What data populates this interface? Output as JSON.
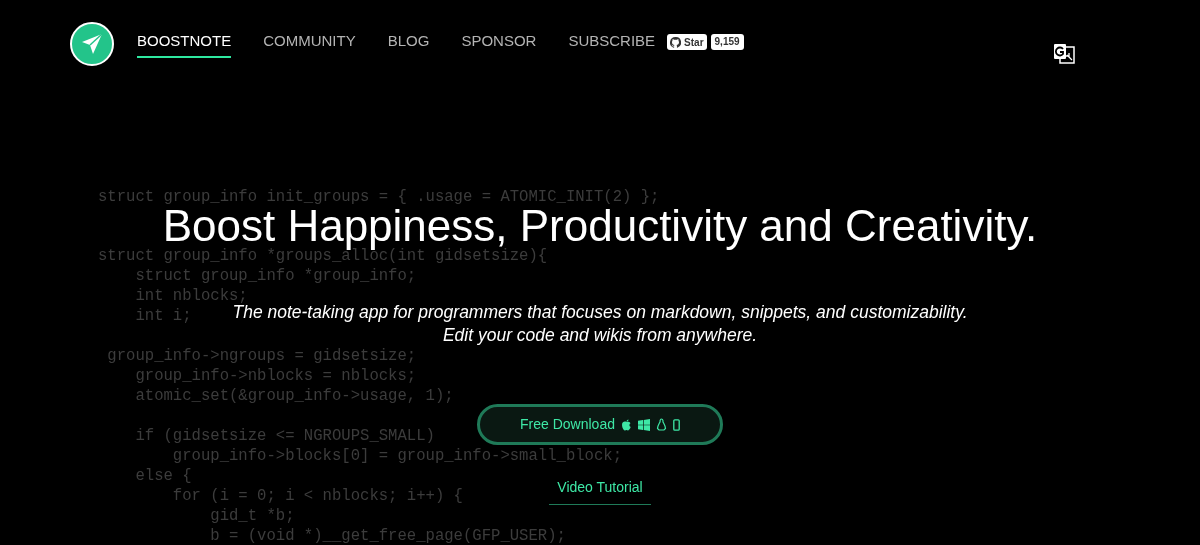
{
  "nav": {
    "items": [
      {
        "label": "BOOSTNOTE",
        "selected": true
      },
      {
        "label": "COMMUNITY",
        "selected": false
      },
      {
        "label": "BLOG",
        "selected": false
      },
      {
        "label": "SPONSOR",
        "selected": false
      },
      {
        "label": "SUBSCRIBE",
        "selected": false
      }
    ],
    "github": {
      "label": "Star",
      "count": "9,159"
    }
  },
  "background_code": [
    {
      "kind": "code",
      "text": "struct group_info init_groups = { .usage = ATOMIC_INIT(2) };"
    },
    {
      "kind": "blank"
    },
    {
      "kind": "code",
      "text": "struct group_info *groups_alloc(int gidsetsize){"
    },
    {
      "kind": "code",
      "text": "    struct group_info *group_info;"
    },
    {
      "kind": "code",
      "text": "    int nblocks;"
    },
    {
      "kind": "code",
      "text": "    int i;"
    },
    {
      "kind": "blank"
    },
    {
      "kind": "code",
      "text": " group_info->ngroups = gidsetsize;"
    },
    {
      "kind": "code",
      "text": "    group_info->nblocks = nblocks;"
    },
    {
      "kind": "code",
      "text": "    atomic_set(&group_info->usage, 1);"
    },
    {
      "kind": "blank"
    },
    {
      "kind": "code",
      "text": "    if (gidsetsize <= NGROUPS_SMALL)"
    },
    {
      "kind": "code",
      "text": "        group_info->blocks[0] = group_info->small_block;"
    },
    {
      "kind": "code",
      "text": "    else {"
    },
    {
      "kind": "code",
      "text": "        for (i = 0; i < nblocks; i++) {"
    },
    {
      "kind": "code",
      "text": "            gid_t *b;"
    },
    {
      "kind": "code",
      "text": "            b = (void *)__get_free_page(GFP_USER);"
    }
  ],
  "hero": {
    "title": "Boost Happiness, Productivity and Creativity.",
    "subtitle": "The note-taking app for programmers that focuses on markdown, snippets, and customizability.",
    "tagline": "Edit your code and wikis from anywhere.",
    "download_button": "Free Download",
    "video_link": "Video Tutorial"
  }
}
